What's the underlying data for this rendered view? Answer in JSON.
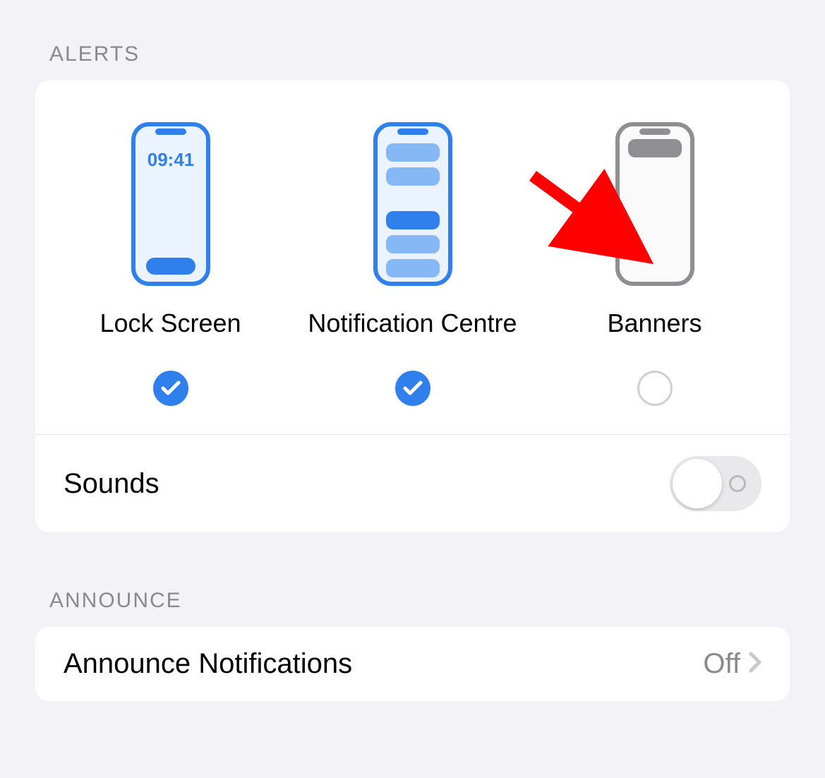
{
  "sections": {
    "alerts": {
      "header": "ALERTS",
      "options": {
        "lockScreen": {
          "label": "Lock Screen",
          "checked": true
        },
        "notificationCentre": {
          "label": "Notification Centre",
          "checked": true
        },
        "banners": {
          "label": "Banners",
          "checked": false
        }
      },
      "sounds": {
        "label": "Sounds",
        "enabled": false
      }
    },
    "announce": {
      "header": "ANNOUNCE",
      "notifications": {
        "label": "Announce Notifications",
        "value": "Off"
      }
    }
  },
  "lockScreenTime": "09:41"
}
